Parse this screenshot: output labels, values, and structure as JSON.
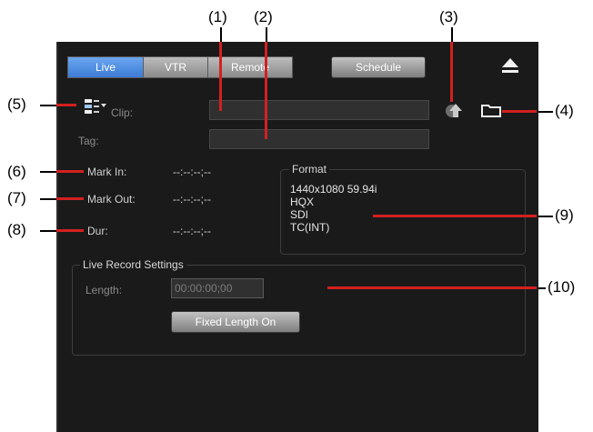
{
  "callouts": {
    "c1": "(1)",
    "c2": "(2)",
    "c3": "(3)",
    "c4": "(4)",
    "c5": "(5)",
    "c6": "(6)",
    "c7": "(7)",
    "c8": "(8)",
    "c9": "(9)",
    "c10": "(10)"
  },
  "tabs": [
    {
      "label": "Live",
      "active": true
    },
    {
      "label": "VTR",
      "active": false
    },
    {
      "label": "Remote",
      "active": false
    }
  ],
  "schedule_label": "Schedule",
  "clip": {
    "label": "Clip:",
    "value": ""
  },
  "tag": {
    "label": "Tag:",
    "value": ""
  },
  "marks": {
    "mark_in_label": "Mark In:",
    "mark_in_value": "--:--:--;--",
    "mark_out_label": "Mark Out:",
    "mark_out_value": "--:--:--;--",
    "dur_label": "Dur:",
    "dur_value": "--:--:--;--"
  },
  "format": {
    "title": "Format",
    "lines": [
      "1440x1080 59.94i",
      "HQX",
      "SDI",
      "TC(INT)"
    ]
  },
  "live_record": {
    "title": "Live Record Settings",
    "length_label": "Length:",
    "length_value": "00:00:00;00",
    "fixed_button": "Fixed Length On"
  },
  "icons": {
    "eject": "eject-icon",
    "folder": "folder-icon",
    "upload": "upload-icon",
    "clip_list": "clip-list-icon"
  }
}
